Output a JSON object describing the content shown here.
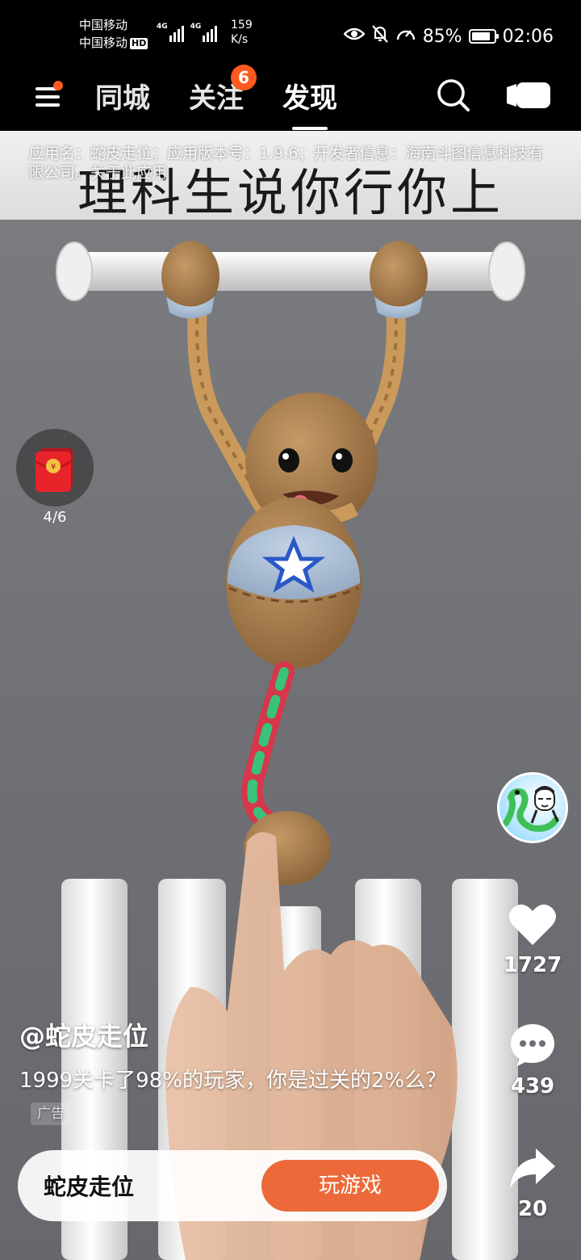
{
  "status_bar": {
    "carrier_1": "中国移动",
    "carrier_2": "中国移动",
    "hd_label": "HD",
    "network_1": "4G",
    "network_2": "4G",
    "net_speed_value": "159",
    "net_speed_unit": "K/s",
    "battery_percent": "85%",
    "battery_level": 0.85,
    "time": "02:06"
  },
  "nav": {
    "tabs": [
      {
        "label": "同城"
      },
      {
        "label": "关注",
        "badge": "6"
      },
      {
        "label": "发现",
        "active": true
      }
    ],
    "icons": [
      "menu-icon",
      "search-icon",
      "camera-icon"
    ]
  },
  "video": {
    "caption": "理科生说你行你上",
    "app_info": "应用名：蛇皮走位；应用版本号：1.9.6；开发者信息：海南斗图信息科技有限公司。关于此应用"
  },
  "red_packet": {
    "progress": "4/6",
    "icon": "red-envelope-icon"
  },
  "actions": {
    "likes": "1727",
    "comments": "439",
    "shares": "20"
  },
  "post": {
    "author": "@蛇皮走位",
    "description": "1999关卡了98%的玩家，你是过关的2%么？",
    "ad_tag": "广告"
  },
  "cta": {
    "name": "蛇皮走位",
    "button": "玩游戏",
    "button_color": "#ec6a3a"
  },
  "colors": {
    "accent": "#ff5a1f",
    "background": "#000000"
  }
}
